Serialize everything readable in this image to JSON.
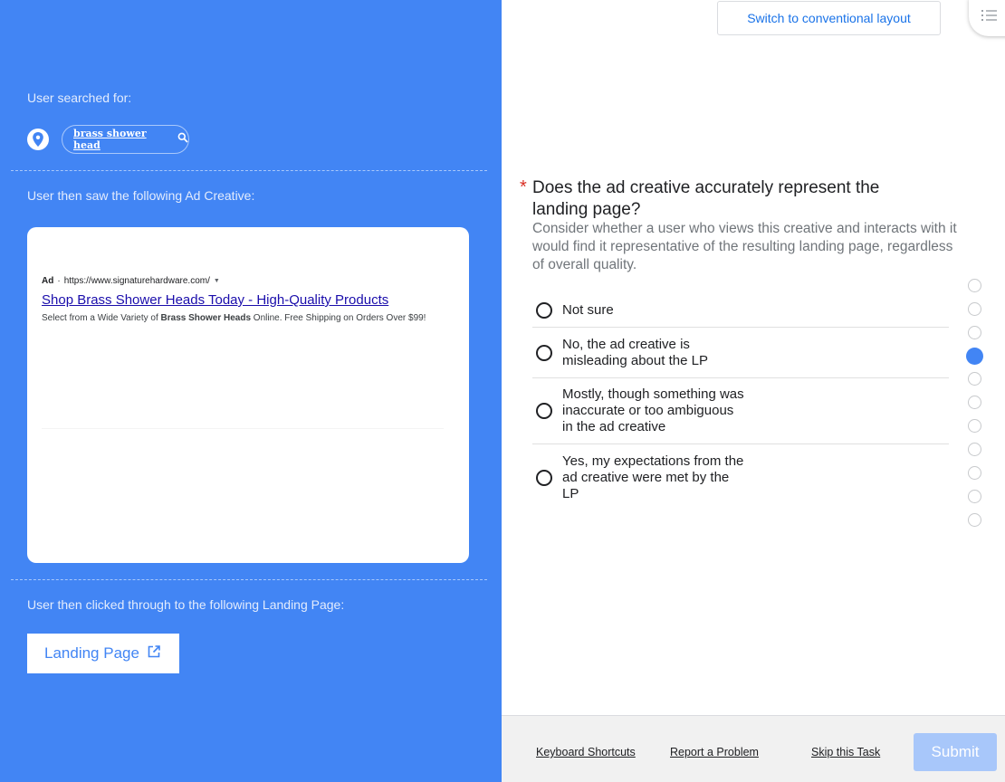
{
  "context": {
    "searched_label": "User searched for:",
    "search_query": "brass shower head",
    "saw_label": "User then saw the following Ad Creative:",
    "clicked_label": "User then clicked through to the following Landing Page:",
    "landing_page_button": "Landing Page"
  },
  "ad": {
    "badge": "Ad",
    "separator": "·",
    "url": "https://www.signaturehardware.com/",
    "title": "Shop Brass Shower Heads Today - High-Quality Products",
    "desc_before": "Select from a Wide Variety of ",
    "desc_bold": "Brass Shower Heads",
    "desc_after": " Online. Free Shipping on Orders Over $99!"
  },
  "header": {
    "switch_layout_label": "Switch to conventional layout"
  },
  "question": {
    "required_mark": "*",
    "title": "Does the ad creative accurately represent the landing page?",
    "help": "Consider whether a user who views this creative and interacts with it would find it representative of the resulting landing page, regardless of overall quality.",
    "options": [
      {
        "label": "Not sure"
      },
      {
        "label": "No, the ad creative is misleading about the LP"
      },
      {
        "label": "Mostly, though something was inaccurate or too ambiguous in the ad creative"
      },
      {
        "label": "Yes, my expectations from the ad creative were met by the LP"
      }
    ]
  },
  "progress": {
    "total": 11,
    "current": 4
  },
  "footer": {
    "keyboard_shortcuts": "Keyboard Shortcuts",
    "report_problem": "Report a Problem",
    "skip_task": "Skip this Task",
    "submit": "Submit"
  },
  "colors": {
    "panel_blue": "#4285f4",
    "link_blue": "#1a73e8",
    "ad_title_blue": "#1a0dab",
    "required_red": "#d93025",
    "submit_disabled": "#a8c7fa"
  }
}
